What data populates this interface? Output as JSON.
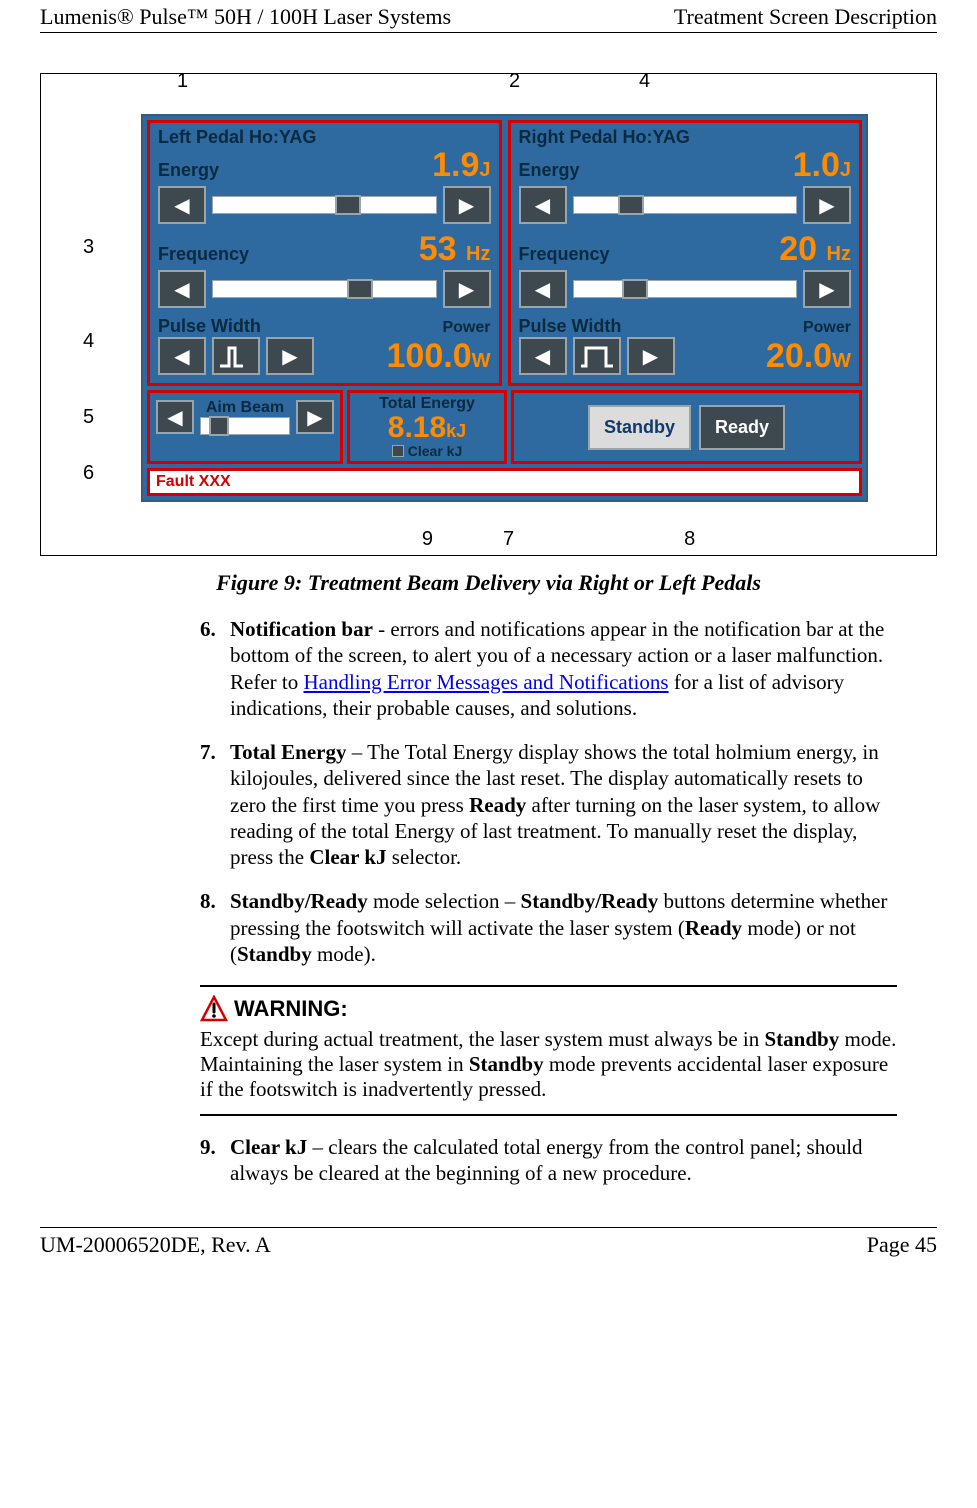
{
  "header": {
    "left": "Lumenis® Pulse™ 50H / 100H Laser Systems",
    "right": "Treatment Screen Description"
  },
  "figure": {
    "callouts_top": {
      "1": "1",
      "2": "2",
      "4t": "4"
    },
    "callouts_left": {
      "3": "3",
      "4l": "4",
      "5": "5",
      "6": "6"
    },
    "callouts_bottom": {
      "9": "9",
      "7": "7",
      "8": "8"
    },
    "left_pedal": {
      "title": "Left Pedal Ho:YAG",
      "energy_label": "Energy",
      "energy_value": "1.9",
      "energy_unit": "J",
      "freq_label": "Frequency",
      "freq_value": "53",
      "freq_unit": "Hz",
      "pw_label": "Pulse Width",
      "power_label": "Power",
      "power_value": "100.0",
      "power_unit": "W"
    },
    "right_pedal": {
      "title": "Right Pedal Ho:YAG",
      "energy_label": "Energy",
      "energy_value": "1.0",
      "energy_unit": "J",
      "freq_label": "Frequency",
      "freq_value": "20",
      "freq_unit": "Hz",
      "pw_label": "Pulse Width",
      "power_label": "Power",
      "power_value": "20.0",
      "power_unit": "W"
    },
    "aim_beam_label": "Aim Beam",
    "total_energy": {
      "title": "Total Energy",
      "value": "8.18",
      "unit": "kJ",
      "clear_label": "Clear kJ"
    },
    "standby_label": "Standby",
    "ready_label": "Ready",
    "fault_text": "Fault XXX",
    "caption": "Figure 9: Treatment Beam Delivery via Right or Left Pedals"
  },
  "items": {
    "6": {
      "num": "6.",
      "title": "Notification bar",
      "text_a": " - errors and notifications appear in the notification bar at the bottom of the screen, to alert you of a necessary action or a laser malfunction. Refer to ",
      "link": "Handling Error Messages and Notifications",
      "text_b": " for a list of advisory indications, their probable causes, and solutions."
    },
    "7": {
      "num": "7.",
      "title": "Total Energy",
      "text_a": " – The Total Energy display shows the total holmium energy, in kilojoules, delivered since the last reset. The display automatically resets to zero the first time you press ",
      "ready": "Ready",
      "text_b": " after turning on the laser system, to allow reading of the total Energy of last treatment. To manually reset the display, press the ",
      "clearkj": "Clear kJ",
      "text_c": " selector."
    },
    "8": {
      "num": "8.",
      "title": "Standby/Ready",
      "text_a": " mode selection – ",
      "sr2": "Standby/Ready",
      "text_b": " buttons determine whether pressing the footswitch will activate the laser system (",
      "ready": "Ready",
      "text_c": " mode) or not (",
      "standby": "Standby",
      "text_d": " mode)."
    },
    "9": {
      "num": "9.",
      "title": "Clear kJ",
      "text": " – clears the calculated total energy from the control panel; should always be cleared at the beginning of a new procedure."
    }
  },
  "warning": {
    "label": "WARNING:",
    "text_a": "Except during actual treatment, the laser system must always be in ",
    "standby1": "Standby",
    "text_b": " mode. Maintaining the laser system in ",
    "standby2": "Standby",
    "text_c": " mode prevents accidental laser exposure if the footswitch is inadvertently pressed."
  },
  "footer": {
    "left": "UM-20006520DE, Rev. A",
    "right": "Page 45"
  }
}
